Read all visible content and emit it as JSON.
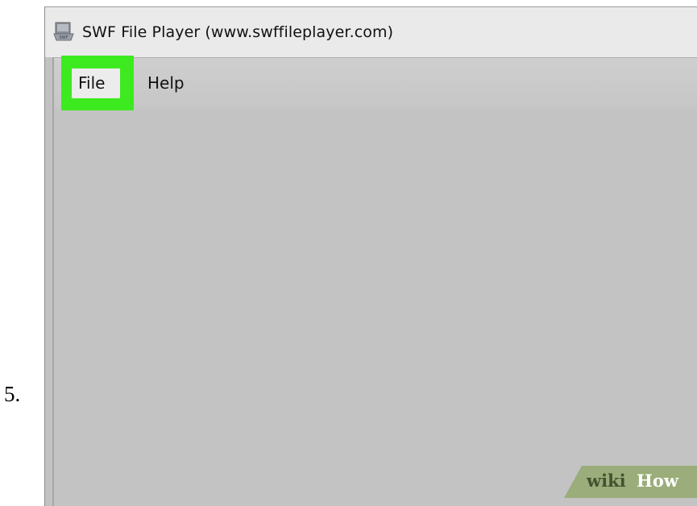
{
  "step": {
    "number": "5."
  },
  "window": {
    "title": "SWF File Player (www.swffileplayer.com)",
    "icon": "swf-app-icon"
  },
  "menu": {
    "items": [
      {
        "label": "File",
        "highlighted": true
      },
      {
        "label": "Help"
      }
    ]
  },
  "watermark": {
    "part1": "wiki",
    "part2": "How"
  },
  "colors": {
    "highlight": "#3dea20",
    "client_background": "#c3c3c3",
    "titlebar": "#eaeaea"
  }
}
